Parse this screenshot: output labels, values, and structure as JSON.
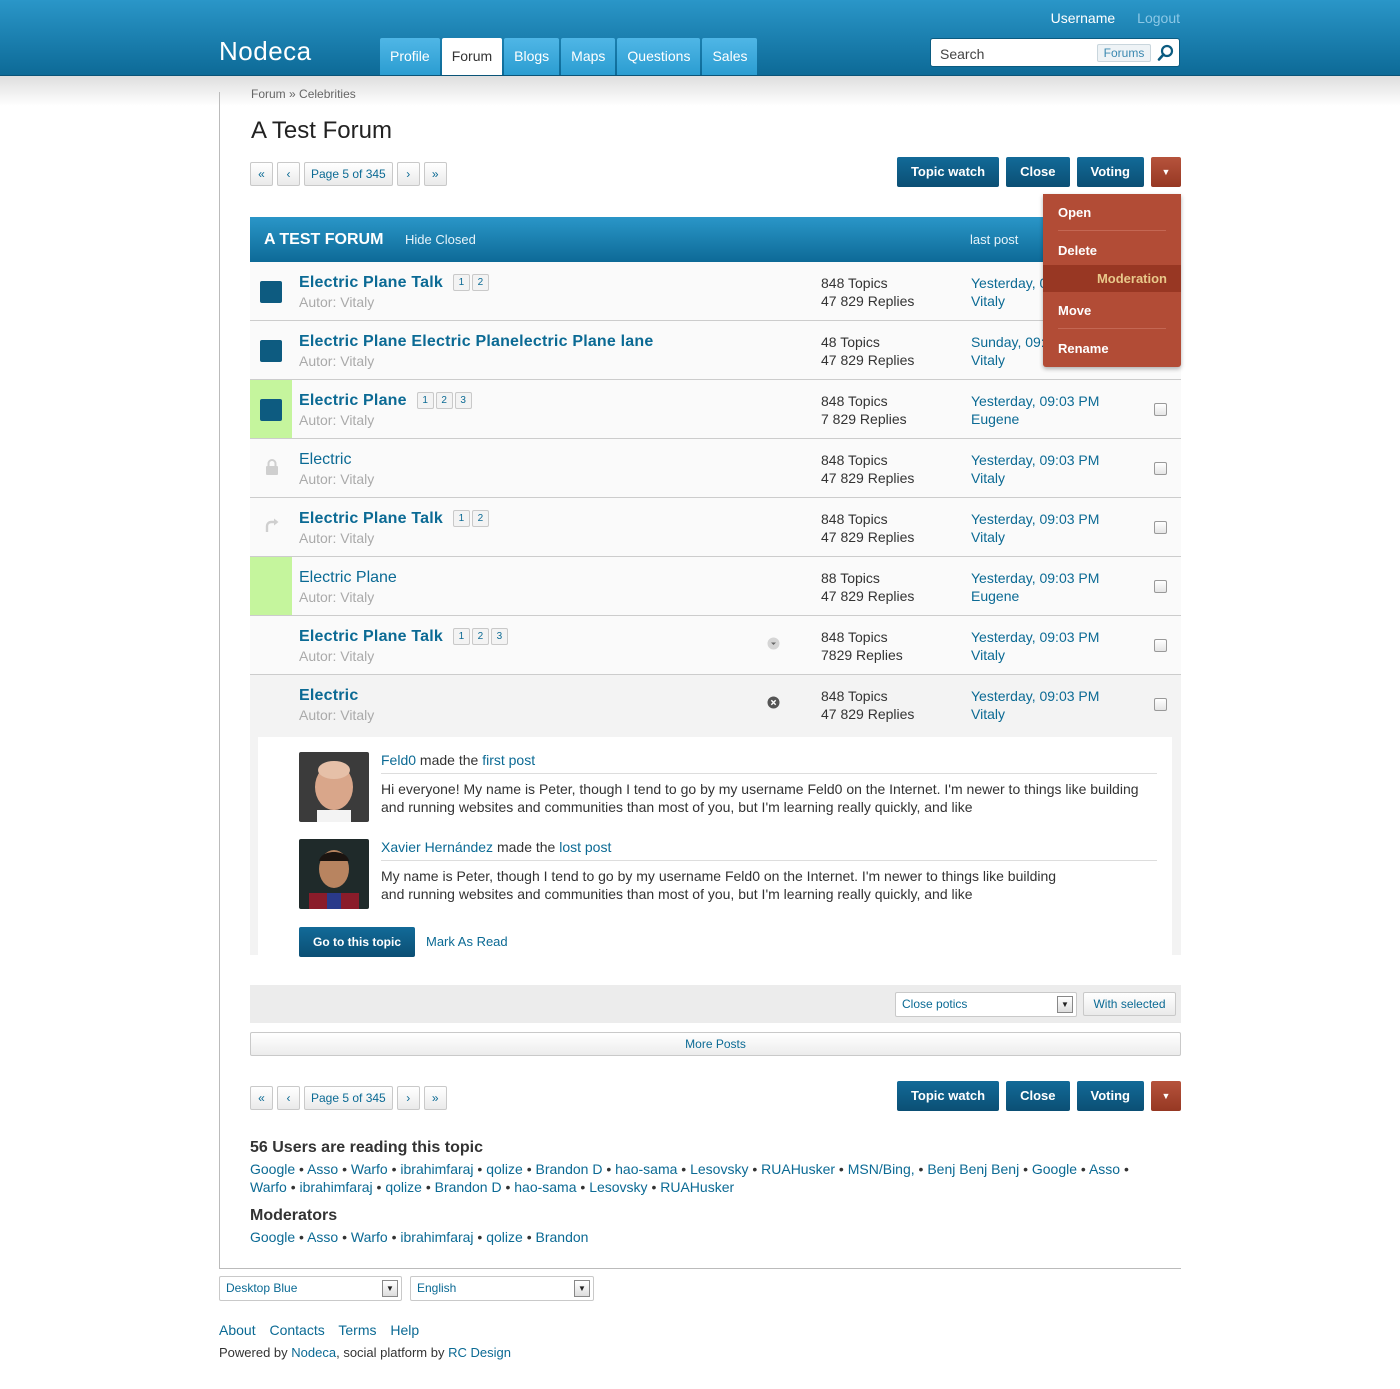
{
  "header": {
    "logo": "Nodeca",
    "username": "Username",
    "logout": "Logout",
    "tabs": [
      {
        "label": "Profile",
        "active": false
      },
      {
        "label": "Forum",
        "active": true
      },
      {
        "label": "Blogs",
        "active": false
      },
      {
        "label": "Maps",
        "active": false
      },
      {
        "label": "Questions",
        "active": false
      },
      {
        "label": "Sales",
        "active": false
      }
    ],
    "search": {
      "placeholder": "Search",
      "scope": "Forums"
    }
  },
  "breadcrumb": {
    "root": "Forum",
    "sep": "»",
    "current": "Celebrities"
  },
  "page_title": "A Test Forum",
  "pager": {
    "first": "«",
    "prev": "‹",
    "label": "Page 5 of 345",
    "next": "›",
    "last": "»"
  },
  "actions": {
    "watch": "Topic watch",
    "close": "Close",
    "voting": "Voting",
    "more": "▼"
  },
  "dropdown": {
    "open": "Open",
    "delete": "Delete",
    "moderation": "Moderation",
    "move": "Move",
    "rename": "Rename"
  },
  "table": {
    "title": "A TEST FORUM",
    "hide_closed": "Hide Closed",
    "last_post": "last post",
    "rows": [
      {
        "title": "Electric Plane Talk",
        "bold": true,
        "pages": [
          "1",
          "2"
        ],
        "author": "Autor: Vitaly",
        "topics": "848 Topics",
        "replies": "47 829 Replies",
        "last_date": "Yesterday, 09:03 PM",
        "last_user": "Vitaly",
        "icon": "square",
        "highlight": false
      },
      {
        "title": "Electric Plane Electric Planelectric Plane lane",
        "bold": true,
        "pages": [],
        "author": "Autor: Vitaly",
        "topics": "48 Topics",
        "replies": "47 829 Replies",
        "last_date": "Sunday, 09:03 PM",
        "last_user": "Vitaly",
        "icon": "square",
        "highlight": false
      },
      {
        "title": "Electric Plane",
        "bold": true,
        "pages": [
          "1",
          "2",
          "3"
        ],
        "author": "Autor: Vitaly",
        "topics": "848 Topics",
        "replies": "7 829 Replies",
        "last_date": "Yesterday, 09:03 PM",
        "last_user": "Eugene",
        "icon": "square",
        "highlight": true
      },
      {
        "title": "Electric",
        "bold": false,
        "pages": [],
        "author": "Autor: Vitaly",
        "topics": "848 Topics",
        "replies": "47 829 Replies",
        "last_date": "Yesterday, 09:03 PM",
        "last_user": "Vitaly",
        "icon": "lock",
        "highlight": false
      },
      {
        "title": "Electric Plane Talk",
        "bold": true,
        "pages": [
          "1",
          "2"
        ],
        "author": "Autor: Vitaly",
        "topics": "848 Topics",
        "replies": "47 829 Replies",
        "last_date": "Yesterday, 09:03 PM",
        "last_user": "Vitaly",
        "icon": "moved",
        "highlight": false
      },
      {
        "title": "Electric Plane",
        "bold": false,
        "pages": [],
        "author": "Autor: Vitaly",
        "topics": "88 Topics",
        "replies": "47 829 Replies",
        "last_date": "Yesterday, 09:03 PM",
        "last_user": "Eugene",
        "icon": "none",
        "highlight": true
      },
      {
        "title": "Electric Plane Talk",
        "bold": true,
        "pages": [
          "1",
          "2",
          "3"
        ],
        "author": "Autor: Vitaly",
        "topics": "848 Topics",
        "replies": "7829 Replies",
        "last_date": "Yesterday, 09:03 PM",
        "last_user": "Vitaly",
        "icon": "none",
        "highlight": false,
        "mini": "expand"
      },
      {
        "title": "Electric",
        "bold": true,
        "pages": [],
        "author": "Autor: Vitaly",
        "topics": "848 Topics",
        "replies": "47 829 Replies",
        "last_date": "Yesterday, 09:03 PM",
        "last_user": "Vitaly",
        "icon": "none",
        "highlight": false,
        "mini": "collapse"
      }
    ]
  },
  "preview": {
    "post1": {
      "user": "Feld0",
      "made": "made the",
      "link": "first post",
      "text": "Hi everyone! My name is Peter, though I tend to go by my username Feld0 on the Internet. I'm newer to things like building and running websites and communities than most of you, but I'm learning really quickly, and like"
    },
    "post2": {
      "user": "Xavier Hernández",
      "made": "made the",
      "link": "lost post",
      "text": "My name is Peter, though I tend to go by my username Feld0 on the Internet. I'm newer to things like building and running websites and communities than most of you, but I'm learning really quickly, and like"
    },
    "go_button": "Go to this topic",
    "mark_read": "Mark As Read"
  },
  "bulk": {
    "select": "Close potics",
    "apply": "With selected"
  },
  "more_posts": "More Posts",
  "readers": {
    "title": "56 Users are reading this topic",
    "names": [
      "Google",
      "Asso",
      "Warfo",
      "ibrahimfaraj",
      "qolize",
      "Brandon D",
      "hao-sama",
      "Lesovsky",
      "RUAHusker",
      "MSN/Bing,",
      "Benj Benj Benj",
      "Google",
      "Asso",
      "Warfo",
      "ibrahimfaraj",
      "qolize",
      "Brandon D",
      "hao-sama",
      "Lesovsky",
      "RUAHusker"
    ]
  },
  "moderators": {
    "title": "Moderators",
    "names": [
      "Google",
      "Asso",
      "Warfo",
      "ibrahimfaraj",
      "qolize",
      "Brandon"
    ]
  },
  "footer": {
    "theme": "Desktop Blue",
    "language": "English",
    "links": [
      "About",
      "Contacts",
      "Terms",
      "Help"
    ],
    "powered_pre": "Powered by",
    "powered_link": "Nodeca",
    "powered_mid": ", social platform by",
    "powered_link2": "RC Design"
  },
  "colors": {
    "brand_blue": "#0d6a97",
    "accent_red": "#b24c36",
    "new_highlight": "#c5f59d"
  }
}
